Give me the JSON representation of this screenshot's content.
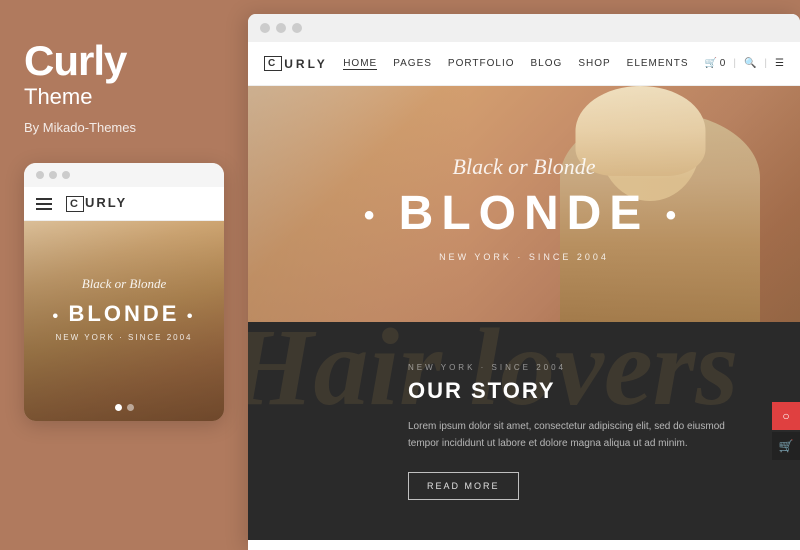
{
  "brand": {
    "title": "Curly",
    "subtitle": "Theme",
    "by": "By Mikado-Themes"
  },
  "mobile": {
    "dots": [
      "",
      "",
      ""
    ],
    "logo_box": "C",
    "logo_text": "URLY",
    "hero_script": "Black or Blonde",
    "hero_main": "BLONDE",
    "hero_sub": "NEW YORK · SINCE 2004",
    "dots_nav": [
      "",
      ""
    ]
  },
  "desktop": {
    "window_dots": [
      "",
      "",
      ""
    ],
    "logo_box": "C",
    "logo_text": "URLY",
    "nav_links": [
      "HOME",
      "PAGES",
      "PORTFOLIO",
      "BLOG",
      "SHOP",
      "ELEMENTS"
    ],
    "nav_active": "HOME",
    "cart_icon": "🛒",
    "search_icon": "🔍",
    "menu_icon": "☰",
    "hero": {
      "script_text": "Black or Blonde",
      "main_text": "BLONDE",
      "sub_text": "NEW YORK · SINCE 2004"
    },
    "story": {
      "bg_text": "Hair lovers",
      "location": "NEW YORK · SINCE 2004",
      "title": "OUR STORY",
      "body": "Lorem ipsum dolor sit amet, consectetur adipiscing elit, sed do eiusmod tempor incididunt ut labore et dolore magna aliqua ut ad minim.",
      "button": "READ MORE"
    },
    "floating_icons": [
      {
        "icon": "○",
        "color": "red"
      },
      {
        "icon": "🛒",
        "color": "dark"
      }
    ]
  }
}
